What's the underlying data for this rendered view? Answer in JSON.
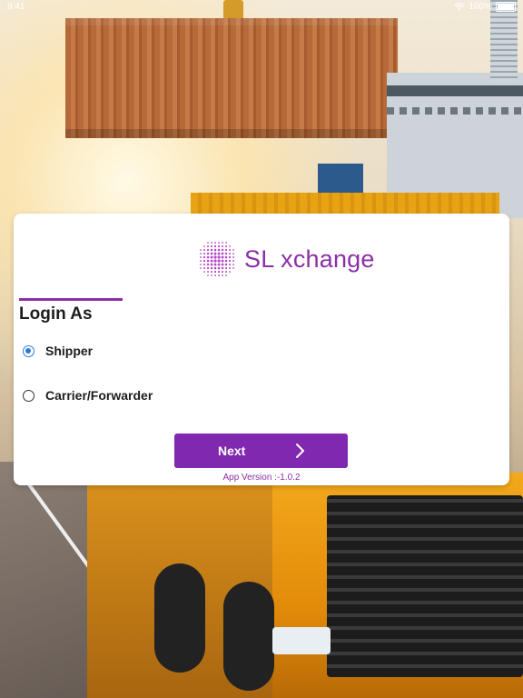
{
  "status_bar": {
    "time": "9:41",
    "battery": "100%"
  },
  "brand": {
    "name": "SL xchange",
    "accent_color": "#8b2fa6",
    "button_color": "#8128b0"
  },
  "login": {
    "heading": "Login As",
    "options": [
      {
        "label": "Shipper",
        "selected": true
      },
      {
        "label": "Carrier/Forwarder",
        "selected": false
      }
    ],
    "next_label": "Next",
    "version": "App Version :-1.0.2"
  },
  "icons": {
    "next": "chevron-right-icon",
    "logo": "globe-dots-icon",
    "wifi": "wifi-icon",
    "battery": "battery-icon"
  }
}
